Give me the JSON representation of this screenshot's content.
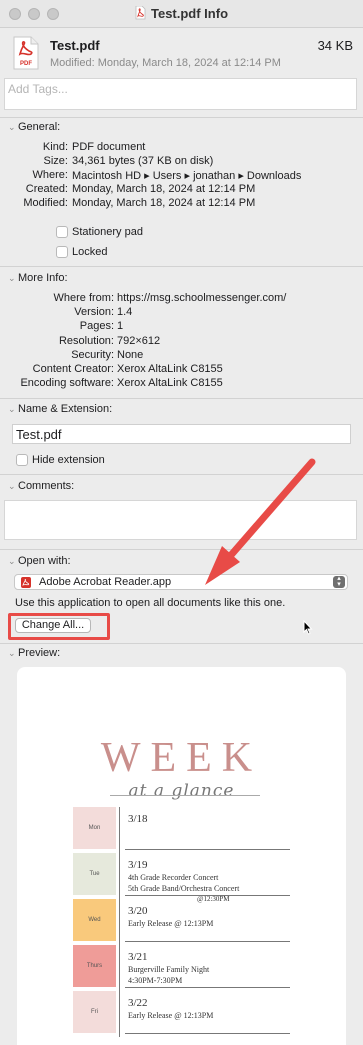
{
  "window": {
    "title": "Test.pdf Info"
  },
  "header": {
    "file_name": "Test.pdf",
    "file_size": "34 KB",
    "modified_line": "Modified: Monday, March 18, 2024 at 12:14 PM",
    "icon_label": "PDF"
  },
  "tags": {
    "placeholder": "Add Tags..."
  },
  "general": {
    "heading": "General:",
    "rows": [
      {
        "label": "Kind:",
        "value": "PDF document"
      },
      {
        "label": "Size:",
        "value": "34,361 bytes (37 KB on disk)"
      },
      {
        "label": "Where:",
        "value": "Macintosh HD ▸ Users ▸ jonathan ▸ Downloads"
      },
      {
        "label": "Created:",
        "value": "Monday, March 18, 2024 at 12:14 PM"
      },
      {
        "label": "Modified:",
        "value": "Monday, March 18, 2024 at 12:14 PM"
      }
    ],
    "stationery_label": "Stationery pad",
    "locked_label": "Locked"
  },
  "more_info": {
    "heading": "More Info:",
    "rows": [
      {
        "label": "Where from:",
        "value": "https://msg.schoolmessenger.com/"
      },
      {
        "label": "Version:",
        "value": "1.4"
      },
      {
        "label": "Pages:",
        "value": "1"
      },
      {
        "label": "Resolution:",
        "value": "792×612"
      },
      {
        "label": "Security:",
        "value": "None"
      },
      {
        "label": "Content Creator:",
        "value": "Xerox AltaLink C8155"
      },
      {
        "label": "Encoding software:",
        "value": "Xerox AltaLink C8155"
      }
    ]
  },
  "name_extension": {
    "heading": "Name & Extension:",
    "value": "Test.pdf",
    "hide_extension_label": "Hide extension"
  },
  "comments": {
    "heading": "Comments:"
  },
  "open_with": {
    "heading": "Open with:",
    "app": "Adobe Acrobat Reader.app",
    "note": "Use this application to open all documents like this one.",
    "change_all_label": "Change All..."
  },
  "preview": {
    "heading": "Preview:",
    "title": "WEEK",
    "subtitle": "at a glance",
    "days": [
      {
        "day": "Mon",
        "date": "3/18",
        "events": [],
        "color": "#f3dcda"
      },
      {
        "day": "Tue",
        "date": "3/19",
        "events": [
          "4th Grade Recorder Concert",
          "5th Grade Band/Orchestra Concert",
          "@12:30PM"
        ],
        "color": "#e6e9dc"
      },
      {
        "day": "Wed",
        "date": "3/20",
        "events": [
          "Early Release @ 12:13PM"
        ],
        "color": "#f9c97c"
      },
      {
        "day": "Thurs",
        "date": "3/21",
        "events": [
          "Burgerville Family Night",
          "4:30PM-7:30PM"
        ],
        "color": "#ef9c98"
      },
      {
        "day": "Fri",
        "date": "3/22",
        "events": [
          "Early Release @ 12:13PM"
        ],
        "color": "#f3dcda"
      }
    ]
  },
  "colors": {
    "annotation_red": "#e84b47",
    "pdf_red": "#d6322a"
  }
}
